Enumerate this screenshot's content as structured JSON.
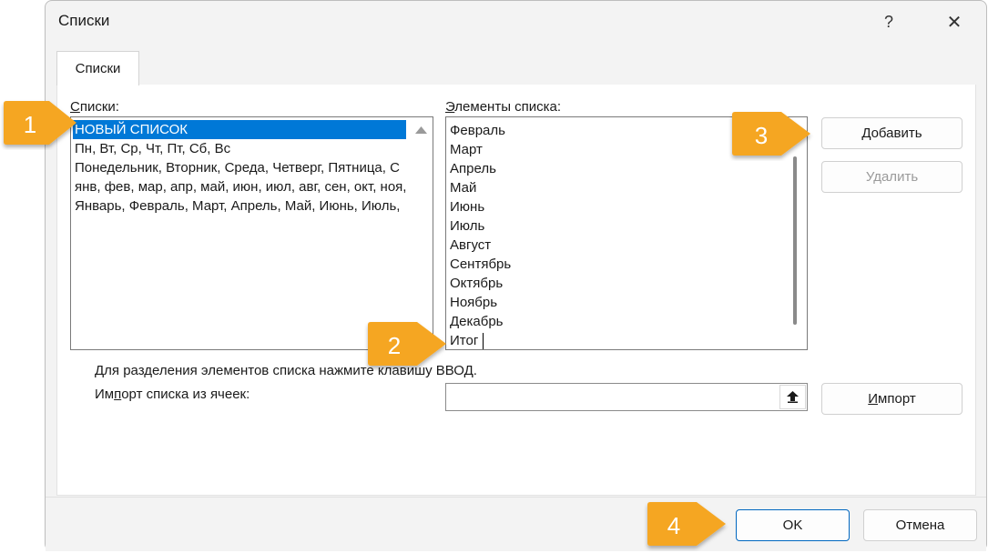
{
  "window": {
    "title": "Списки",
    "help_glyph": "?",
    "close_glyph": "✕"
  },
  "tab": {
    "label": "Списки"
  },
  "lists": {
    "label_first": "С",
    "label_rest": "писки:",
    "items": [
      "НОВЫЙ СПИСОК",
      "Пн, Вт, Ср, Чт, Пт, Сб, Вс",
      "Понедельник, Вторник, Среда, Четверг, Пятница, С",
      "янв, фев, мар, апр, май, июн, июл, авг, сен, окт, ноя,",
      "Январь, Февраль, Март, Апрель, Май, Июнь, Июль,"
    ],
    "selected_index": 0
  },
  "elements": {
    "label_first": "Э",
    "label_rest": "лементы списка:",
    "items": [
      "Февраль",
      "Март",
      "Апрель",
      "Май",
      "Июнь",
      "Июль",
      "Август",
      "Сентябрь",
      "Октябрь",
      "Ноябрь",
      "Декабрь",
      "Итог"
    ]
  },
  "buttons": {
    "add_first": "Д",
    "add_rest": "обавить",
    "delete": "Удалить",
    "import_first": "И",
    "import_rest": "мпорт",
    "ok": "OK",
    "cancel": "Отмена"
  },
  "hint": "Для разделения элементов списка нажмите клавишу ВВОД.",
  "import": {
    "label_pre": "Им",
    "label_ul": "п",
    "label_post": "орт списка из ячеек:",
    "value": ""
  },
  "callouts": [
    "1",
    "2",
    "3",
    "4"
  ],
  "colors": {
    "selection": "#0078d7",
    "callout": "#f5a623",
    "primary_border": "#0067c0"
  }
}
